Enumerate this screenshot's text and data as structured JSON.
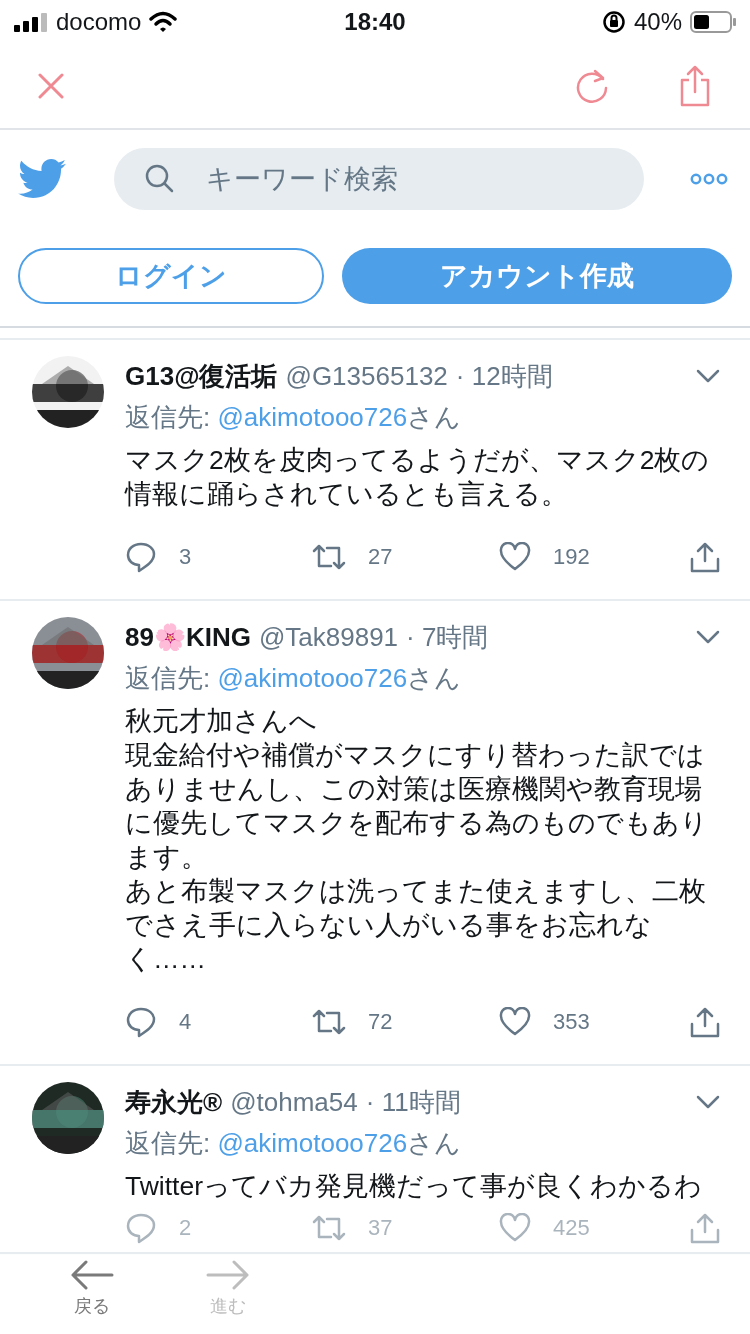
{
  "status_bar": {
    "carrier": "docomo",
    "time": "18:40",
    "battery": "40%"
  },
  "search": {
    "placeholder": "キーワード検索"
  },
  "auth_buttons": [
    {
      "label": "ログイン",
      "kind": "outline"
    },
    {
      "label": "アカウント作成",
      "kind": "filled"
    }
  ],
  "tweets": [
    {
      "name": "G13@復活垢",
      "handle": "@G13565132",
      "time": "· 12時間",
      "reply_label": "返信先:",
      "reply_to": "@akimotooo726",
      "reply_suffix": "さん",
      "text": [
        "マスク2枚を皮肉ってるようだが、マスク2枚の情報に踊らされているとも言える。"
      ],
      "replies": "3",
      "retweets": "27",
      "likes": "192"
    },
    {
      "name": "89🌸KING",
      "handle": "@Tak89891",
      "time": "· 7時間",
      "reply_label": "返信先:",
      "reply_to": "@akimotooo726",
      "reply_suffix": "さん",
      "text": [
        "秋元才加さんへ",
        "現金給付や補償がマスクにすり替わった訳ではありませんし、この対策は医療機関や教育現場に優先してマスクを配布する為のものでもあります。",
        "あと布製マスクは洗ってまた使えますし、二枚でさえ手に入らない人がいる事をお忘れなく……"
      ],
      "replies": "4",
      "retweets": "72",
      "likes": "353"
    },
    {
      "name": "寿永光®",
      "handle": "@tohma54",
      "time": "· 11時間",
      "reply_label": "返信先:",
      "reply_to": "@akimotooo726",
      "reply_suffix": "さん",
      "text": [
        "Twitterってバカ発見機だって事が良くわかるわ"
      ],
      "replies": "2",
      "retweets": "37",
      "likes": "425"
    }
  ],
  "toolbar": [
    {
      "label": "戻る",
      "kind": "back",
      "disabled": false
    },
    {
      "label": "進む",
      "kind": "forward",
      "disabled": true
    }
  ]
}
